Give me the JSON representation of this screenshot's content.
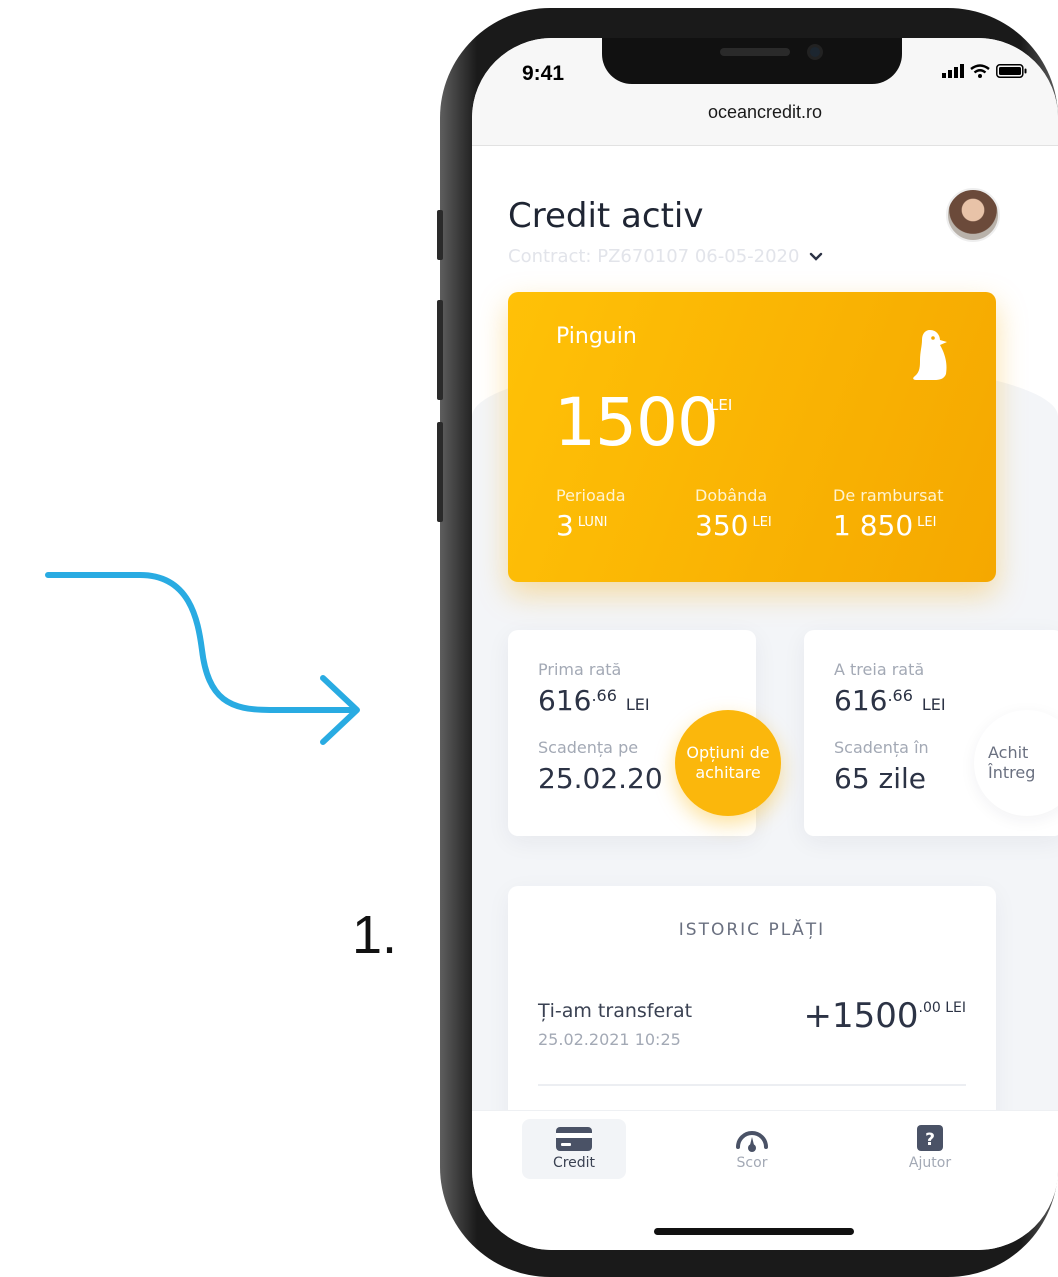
{
  "annotation": {
    "step_number": "1."
  },
  "browser": {
    "time": "9:41",
    "url": "oceancredit.ro"
  },
  "header": {
    "title": "Credit activ",
    "contract": "Contract: PZ670107 06-05-2020"
  },
  "credit_card": {
    "name": "Pinguin",
    "amount": "1500",
    "currency": "LEI",
    "stats": [
      {
        "label": "Perioada",
        "value": "3",
        "unit": "LUNI"
      },
      {
        "label": "Dobânda",
        "value": "350",
        "unit": "LEI"
      },
      {
        "label": "De rambursat",
        "value": "1 850",
        "unit": "LEI"
      }
    ]
  },
  "rates": [
    {
      "label": "Prima rată",
      "amount_int": "616",
      "amount_dec": ".66",
      "currency": "LEI",
      "due_label": "Scadența pe",
      "due_value": "25.02.20",
      "action": "Opțiuni de achitare"
    },
    {
      "label": "A treia rată",
      "amount_int": "616",
      "amount_dec": ".66",
      "currency": "LEI",
      "due_label": "Scadența în",
      "due_value": "65 zile",
      "action_line1": "Achit",
      "action_line2": "Întreg"
    }
  ],
  "history": {
    "title": "ISTORIC PLĂȚI",
    "transactions": [
      {
        "title": "Ți-am transferat",
        "date": "25.02.2021 10:25",
        "amount": "+1500",
        "amount_dec": ".00 LEI"
      }
    ]
  },
  "tabbar": {
    "tabs": [
      {
        "label": "Credit",
        "active": true
      },
      {
        "label": "Scor",
        "active": false
      },
      {
        "label": "Ajutor",
        "active": false
      }
    ]
  },
  "colors": {
    "accent": "#fbb70c",
    "arrow": "#29abe2",
    "text": "#2c3345"
  }
}
